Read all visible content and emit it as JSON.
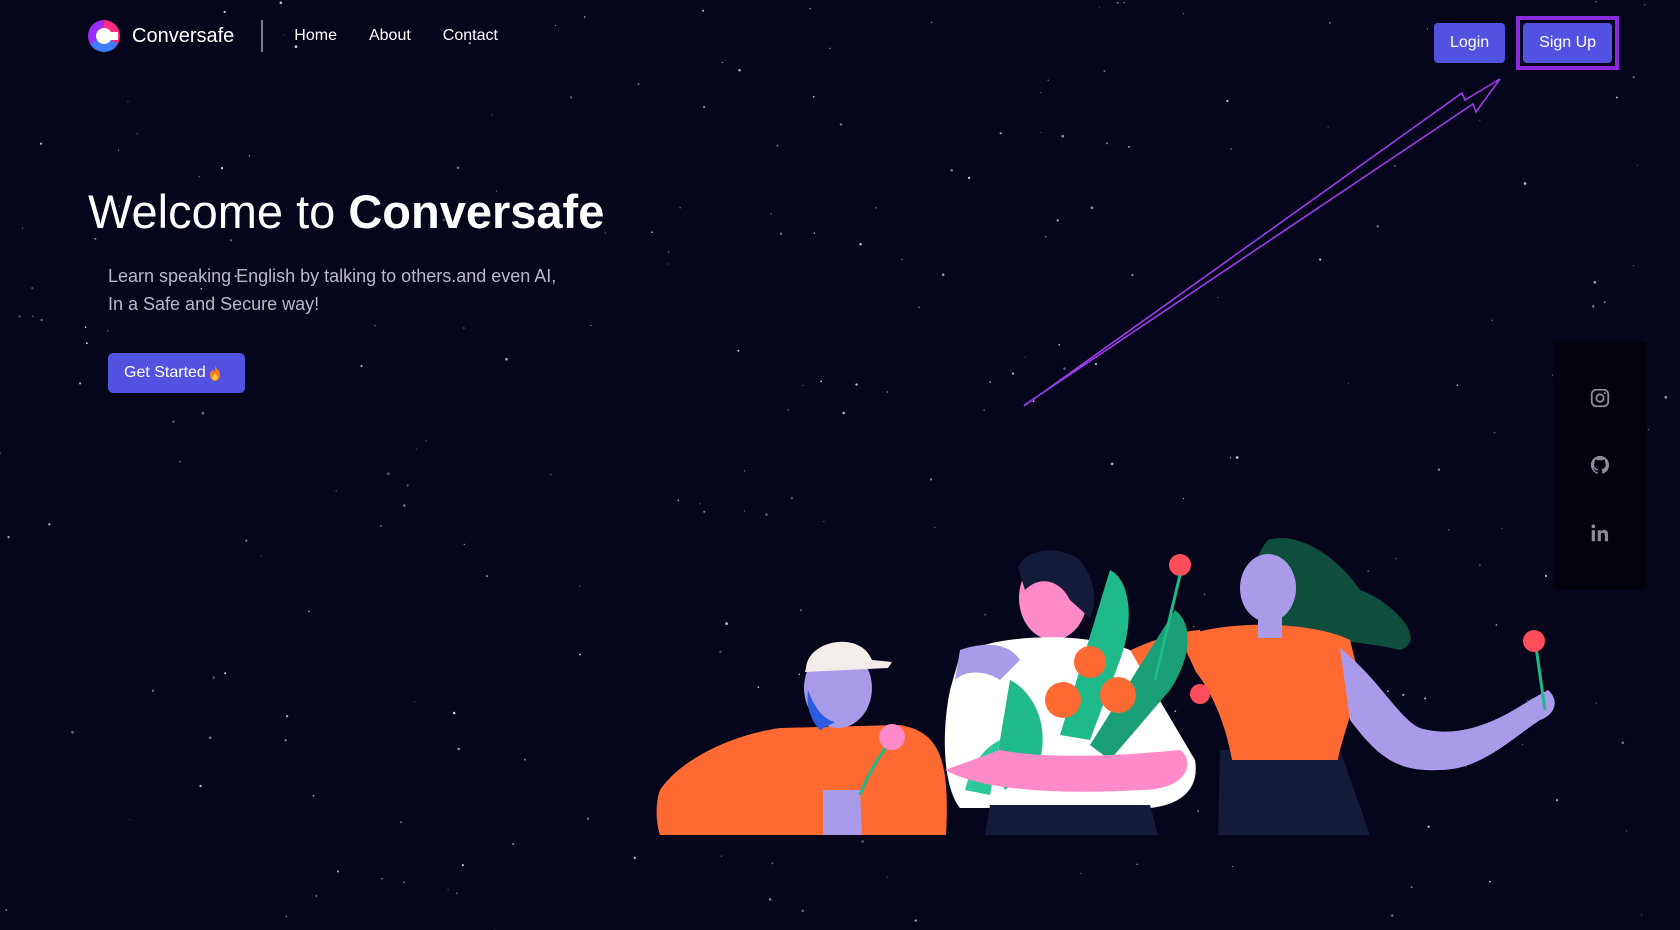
{
  "header": {
    "brand": "Conversafe",
    "nav": [
      "Home",
      "About",
      "Contact"
    ],
    "login_label": "Login",
    "signup_label": "Sign Up"
  },
  "hero": {
    "title_prefix": "Welcome to ",
    "title_brand": "Conversafe",
    "subtitle_line1": "Learn speaking English by talking to others.and even AI,",
    "subtitle_line2": "In a Safe and Secure way!",
    "cta_label": "Get Started"
  },
  "social": {
    "icons": [
      "instagram-icon",
      "github-icon",
      "linkedin-icon"
    ]
  },
  "colors": {
    "background": "#05051c",
    "accent": "#5252e0",
    "highlight": "#8a2be2",
    "illustration_orange": "#ff6a33",
    "illustration_purple": "#a99bea",
    "illustration_pink": "#ff8ac8",
    "illustration_green": "#1fb98a"
  }
}
